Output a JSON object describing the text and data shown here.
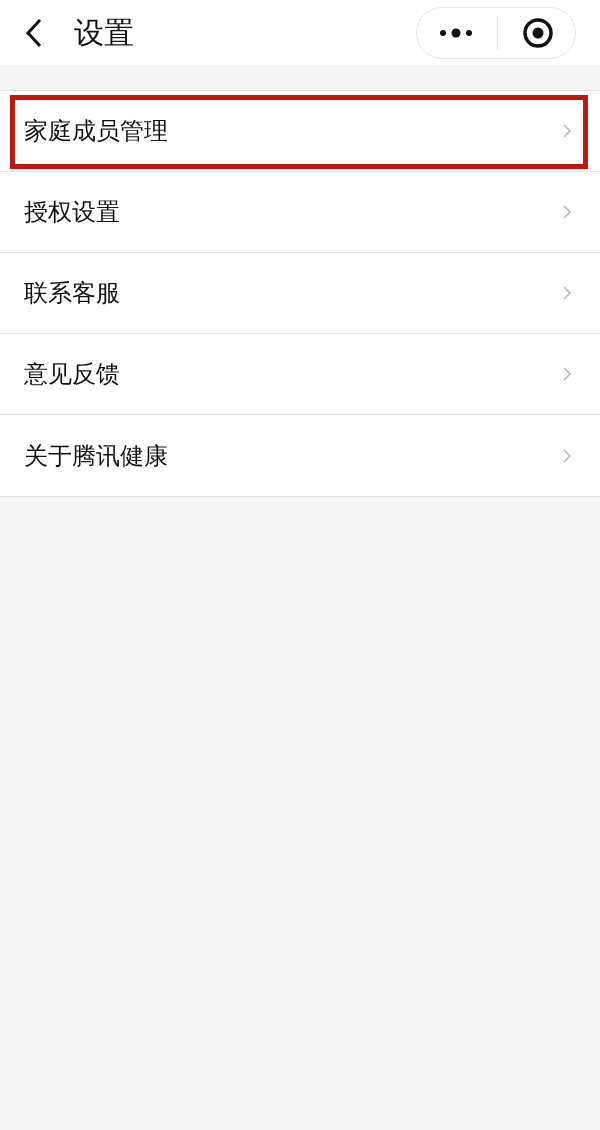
{
  "header": {
    "title": "设置"
  },
  "items": [
    {
      "label": "家庭成员管理",
      "highlighted": true
    },
    {
      "label": "授权设置",
      "highlighted": false
    },
    {
      "label": "联系客服",
      "highlighted": false
    },
    {
      "label": "意见反馈",
      "highlighted": false
    },
    {
      "label": "关于腾讯健康",
      "highlighted": false
    }
  ]
}
